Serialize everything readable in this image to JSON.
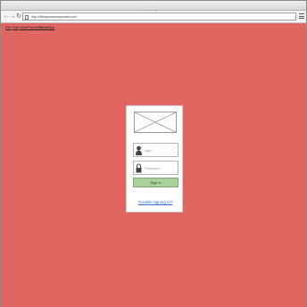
{
  "window": {
    "title": "A Web Page"
  },
  "toolbar": {
    "back_icon": "arrow-left-icon",
    "forward_icon": "arrow-right-icon",
    "reload_icon": "reload-icon",
    "url": "http://lifeapproachapproach.com",
    "menu_icon": "hamburger-menu-icon"
  },
  "menubar": {
    "items": [
      "File",
      "Edit",
      "View",
      "Favorites",
      "Tools",
      "Help"
    ]
  },
  "login": {
    "logo_placeholder": "image-placeholder",
    "login_placeholder": "login",
    "password_placeholder": "Password",
    "signin_label": "Sign in",
    "trouble_link": "Trouble signing in?"
  },
  "colors": {
    "background": "#e06662",
    "signin_button": "#a9d29a",
    "link": "#2f6fcf"
  }
}
